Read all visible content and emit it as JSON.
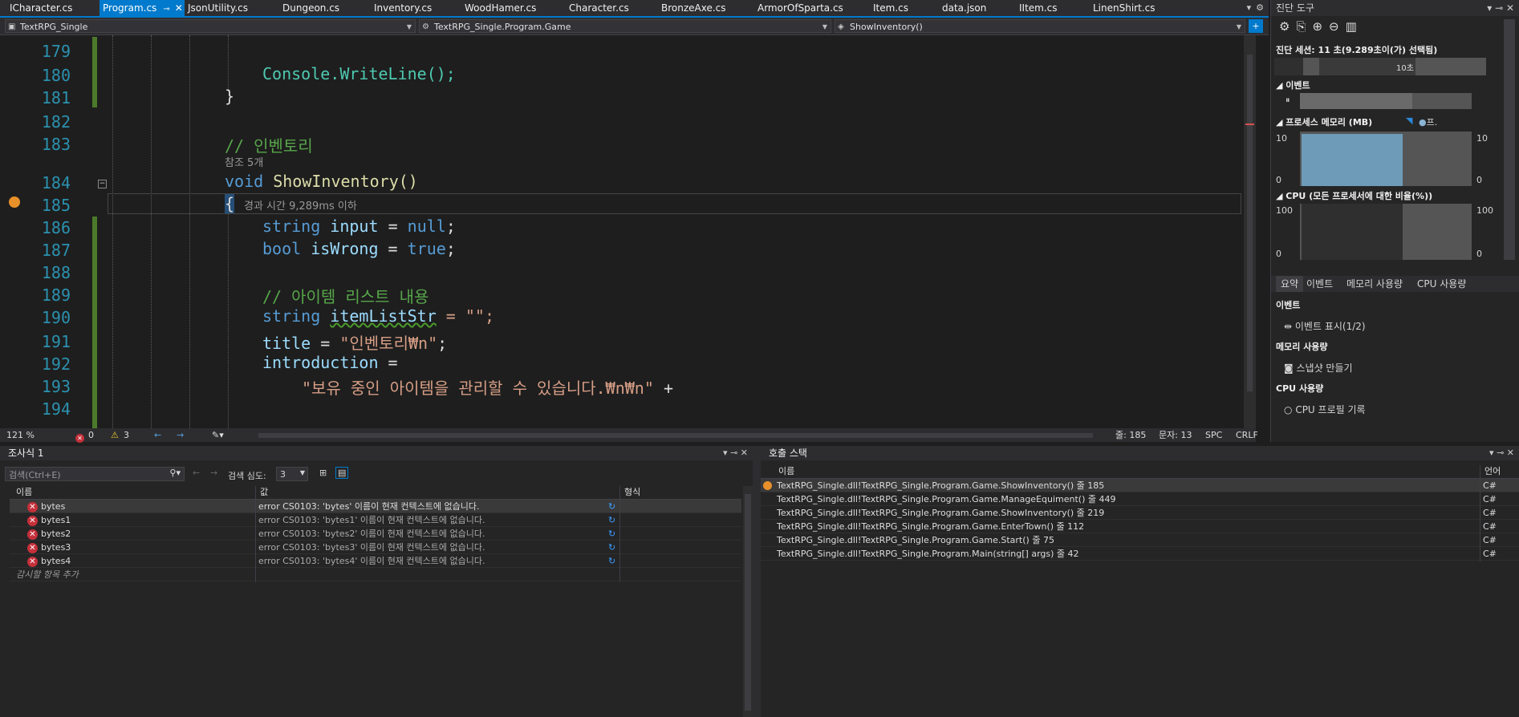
{
  "tabs": [
    {
      "label": "ICharacter.cs",
      "active": false
    },
    {
      "label": "Program.cs",
      "active": true
    },
    {
      "label": "JsonUtility.cs",
      "active": false
    },
    {
      "label": "Dungeon.cs",
      "active": false
    },
    {
      "label": "Inventory.cs",
      "active": false
    },
    {
      "label": "WoodHamer.cs",
      "active": false
    },
    {
      "label": "Character.cs",
      "active": false
    },
    {
      "label": "BronzeAxe.cs",
      "active": false
    },
    {
      "label": "ArmorOfSparta.cs",
      "active": false
    },
    {
      "label": "Item.cs",
      "active": false
    },
    {
      "label": "data.json",
      "active": false
    },
    {
      "label": "IItem.cs",
      "active": false
    },
    {
      "label": "LinenShirt.cs",
      "active": false
    }
  ],
  "navbar": {
    "project": "TextRPG_Single",
    "class": "TextRPG_Single.Program.Game",
    "member": "ShowInventory()"
  },
  "editor": {
    "lines": [
      "179",
      "180",
      "181",
      "182",
      "183",
      "184",
      "185",
      "186",
      "187",
      "188",
      "189",
      "190",
      "191",
      "192",
      "193",
      "194"
    ],
    "code": {
      "l180_fn": "Console.WriteLine();",
      "l181": "}",
      "l183": "// 인벤토리",
      "l183_hint": "참조 5개",
      "l184_kw": "void",
      "l184_fn": "ShowInventory()",
      "l185": "{",
      "l185_hint": "경과 시간 9,289ms 이하",
      "l186_kw": "string",
      "l186_var": "input",
      "l186_eq": "=",
      "l186_null": "null",
      "l187_kw": "bool",
      "l187_var": "isWrong",
      "l187_true": "true",
      "l189": "// 아이템 리스트 내용",
      "l190_kw": "string",
      "l190_var": "itemListStr",
      "l190_rest": "= \"\";",
      "l192_var": "title",
      "l192_str": "\"인벤토리₩n\"",
      "l193_var": "introduction",
      "l194_str": "\"보유 중인 아이템을 관리할 수 있습니다.₩n₩n\"",
      "l194_plus": "+"
    }
  },
  "editor_status": {
    "zoom": "121 %",
    "errors": "0",
    "warnings": "3",
    "line": "줄: 185",
    "col": "문자: 13",
    "spc": "SPC",
    "crlf": "CRLF"
  },
  "diag": {
    "title": "진단 도구",
    "session": "진단 세션: 11 초(9.289초이(가) 선택됨)",
    "timeline_label": "10초",
    "events_label": "이벤트",
    "memory_label": "프로세스 메모리 (MB)",
    "memory_legend": "프.",
    "mem_max": "10",
    "mem_min": "0",
    "cpu_label": "CPU (모든 프로세서에 대한 비율(%))",
    "cpu_max": "100",
    "cpu_min": "0",
    "tabs": [
      "요약",
      "이벤트",
      "메모리 사용량",
      "CPU 사용량"
    ],
    "sec_events": "이벤트",
    "show_events": "이벤트 표시(1/2)",
    "sec_memory": "메모리 사용량",
    "snapshot": "스냅샷 만들기",
    "sec_cpu": "CPU 사용량",
    "cpu_profile": "CPU 프로필 기록",
    "memory_level": 0.95
  },
  "watch": {
    "title": "조사식 1",
    "search_placeholder": "검색(Ctrl+E)",
    "depth_label": "검색 심도:",
    "depth_value": "3",
    "col_name": "이름",
    "col_value": "값",
    "col_type": "형식",
    "rows": [
      {
        "name": "bytes",
        "value": "error CS0103: 'bytes' 이름이 현재 컨텍스트에 없습니다."
      },
      {
        "name": "bytes1",
        "value": "error CS0103: 'bytes1' 이름이 현재 컨텍스트에 없습니다."
      },
      {
        "name": "bytes2",
        "value": "error CS0103: 'bytes2' 이름이 현재 컨텍스트에 없습니다."
      },
      {
        "name": "bytes3",
        "value": "error CS0103: 'bytes3' 이름이 현재 컨텍스트에 없습니다."
      },
      {
        "name": "bytes4",
        "value": "error CS0103: 'bytes4' 이름이 현재 컨텍스트에 없습니다."
      }
    ],
    "add_item": "감시할 항목 추가"
  },
  "callstack": {
    "title": "호출 스택",
    "col_name": "이름",
    "col_lang": "언어",
    "rows": [
      {
        "name": "TextRPG_Single.dll!TextRPG_Single.Program.Game.ShowInventory() 줄 185",
        "lang": "C#"
      },
      {
        "name": "TextRPG_Single.dll!TextRPG_Single.Program.Game.ManageEquiment() 줄 449",
        "lang": "C#"
      },
      {
        "name": "TextRPG_Single.dll!TextRPG_Single.Program.Game.ShowInventory() 줄 219",
        "lang": "C#"
      },
      {
        "name": "TextRPG_Single.dll!TextRPG_Single.Program.Game.EnterTown() 줄 112",
        "lang": "C#"
      },
      {
        "name": "TextRPG_Single.dll!TextRPG_Single.Program.Game.Start() 줄 75",
        "lang": "C#"
      },
      {
        "name": "TextRPG_Single.dll!TextRPG_Single.Program.Main(string[] args) 줄 42",
        "lang": "C#"
      }
    ]
  },
  "colors": {
    "accent": "#007acc",
    "error": "#c5303b",
    "warning": "#e8c42a",
    "breakpoint": "#e8902a"
  }
}
